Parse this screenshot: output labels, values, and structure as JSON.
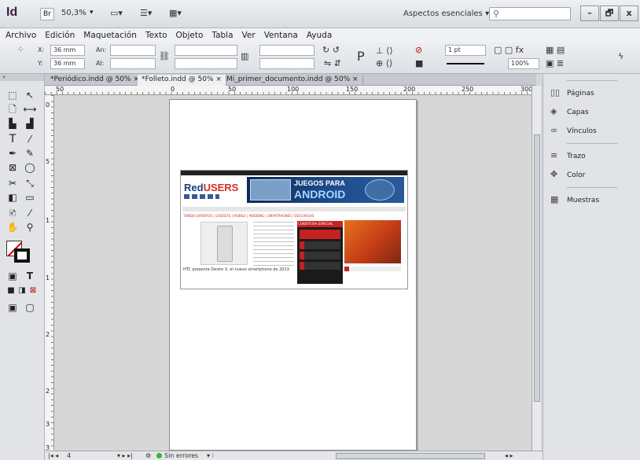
{
  "app": {
    "logo": "Id",
    "bridge": "Br",
    "zoom": "50,3%",
    "workspace": "Aspectos esenciales",
    "workspace_arrow": "▾"
  },
  "window_controls": {
    "minimize": "–",
    "restore": "🗗",
    "close": "x"
  },
  "menu": [
    "Archivo",
    "Edición",
    "Maquetación",
    "Texto",
    "Objeto",
    "Tabla",
    "Ver",
    "Ventana",
    "Ayuda"
  ],
  "control": {
    "x_label": "X:",
    "x_value": "36 mm",
    "y_label": "Y:",
    "y_value": "36 mm",
    "w_label": "An:",
    "h_label": "Al:",
    "stroke_weight": "1 pt",
    "opacity": "100%"
  },
  "tabs": [
    {
      "label": "*Periódico.indd @ 50%",
      "close": "×"
    },
    {
      "label": "*Folleto.indd @ 50%",
      "close": "×"
    },
    {
      "label": "Mi_primer_documento.indd @ 50%",
      "close": "×"
    }
  ],
  "ruler": {
    "h": [
      "50",
      "0",
      "50",
      "100",
      "150",
      "200",
      "250",
      "300"
    ],
    "v": [
      "0",
      "5",
      "1",
      "1",
      "2",
      "2",
      "3",
      "3"
    ]
  },
  "placed_page": {
    "logo_red": "Red",
    "logo_users": "USERS",
    "banner_line1": "JUEGOS PARA",
    "banner_line2": "ANDROID",
    "categories": "TIENDA EXPERTOS | GADGETS | MOBILE | MODDING | SMARTPHONES | DESCARGAS",
    "feature_header": "COBERTURA ESPECIAL",
    "caption": "HTC presenta Desire X, el nuevo smartphone de 2013"
  },
  "panels": [
    {
      "label": "Páginas",
      "icon": "pages-icon"
    },
    {
      "label": "Capas",
      "icon": "layers-icon"
    },
    {
      "label": "Vínculos",
      "icon": "links-icon"
    },
    {
      "label": "Trazo",
      "icon": "stroke-icon"
    },
    {
      "label": "Color",
      "icon": "color-icon"
    },
    {
      "label": "Muestras",
      "icon": "swatches-icon"
    }
  ],
  "status": {
    "page": "4",
    "preflight": "Sin errores"
  }
}
